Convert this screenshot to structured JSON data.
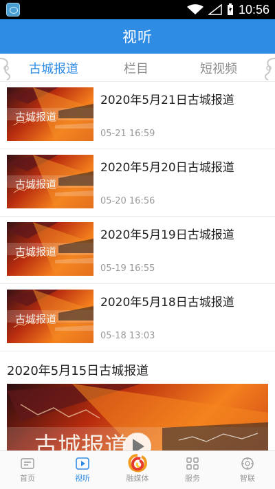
{
  "status_bar": {
    "time": "10:56",
    "app_icon": "app-icon",
    "icons": [
      "wifi-icon",
      "signal-icon",
      "battery-icon"
    ]
  },
  "header": {
    "title": "视听"
  },
  "tabs": [
    {
      "label": "古城报道",
      "active": true
    },
    {
      "label": "栏目",
      "active": false
    },
    {
      "label": "短视频",
      "active": false
    }
  ],
  "thumbnail_text": "古城报道",
  "news": [
    {
      "title": "2020年5月21日古城报道",
      "time": "05-21 16:59"
    },
    {
      "title": "2020年5月20日古城报道",
      "time": "05-20 16:56"
    },
    {
      "title": "2020年5月19日古城报道",
      "time": "05-19 16:55"
    },
    {
      "title": "2020年5月18日古城报道",
      "time": "05-18 13:03"
    }
  ],
  "featured": {
    "title": "2020年5月15日古城报道",
    "media_text": "古城报道"
  },
  "bottom_nav": [
    {
      "label": "首页",
      "icon": "home-icon",
      "active": false
    },
    {
      "label": "视听",
      "icon": "video-icon",
      "active": true
    },
    {
      "label": "融媒体",
      "icon": "media-logo-icon",
      "active": false
    },
    {
      "label": "服务",
      "icon": "services-icon",
      "active": false
    },
    {
      "label": "智联",
      "icon": "smart-link-icon",
      "active": false
    }
  ],
  "colors": {
    "primary": "#2f8ce5",
    "text": "#222222",
    "muted": "#999999",
    "thumbnail_orange": "#f4801d",
    "thumbnail_red": "#b92d0f"
  }
}
